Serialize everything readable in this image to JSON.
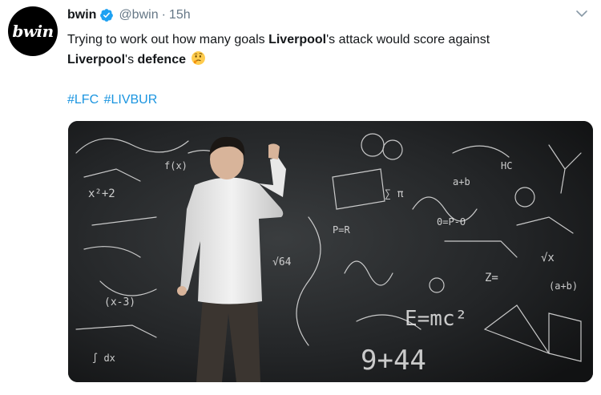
{
  "tweet": {
    "avatar_text": "bwin",
    "display_name": "bwin",
    "handle": "@bwin",
    "separator": "·",
    "time": "15h",
    "text_part1": "Trying to work out how many goals ",
    "text_bold1": "Liverpool",
    "text_part2": "'s attack would score against ",
    "text_bold2": "Liverpool",
    "text_part3": "'s ",
    "text_bold3": "defence",
    "hashtags": [
      "#LFC",
      "#LIVBUR"
    ]
  },
  "icons": {
    "verified": "verified-badge-icon",
    "chevron": "chevron-down-icon",
    "emoji": "thinking-face-emoji"
  },
  "colors": {
    "link": "#1b95e0",
    "muted": "#657786",
    "verified": "#1da1f2"
  }
}
